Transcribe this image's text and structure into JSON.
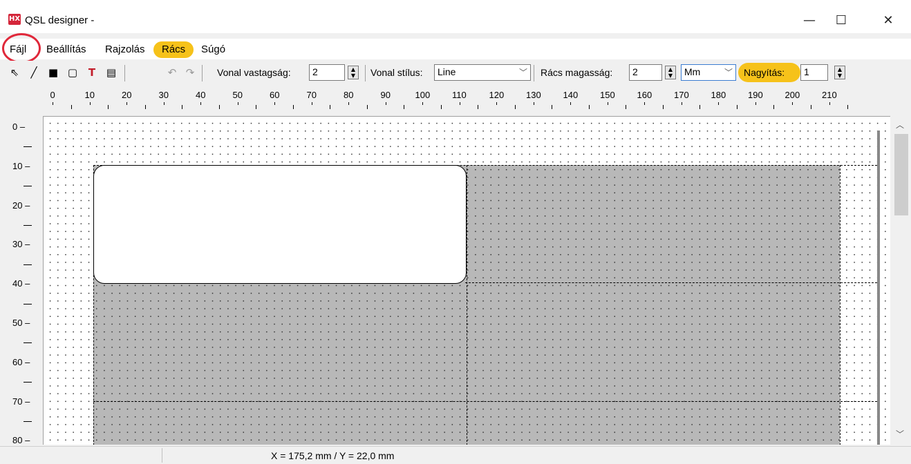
{
  "window": {
    "title": "QSL designer -",
    "minimize": "—",
    "maximize": "☐",
    "close": "✕"
  },
  "menu": [
    "Fájl",
    "Beállítás",
    "Rajzolás",
    "Rács",
    "Súgó"
  ],
  "toolbar": {
    "line_width_label": "Vonal vastagság:",
    "line_width_value": "2",
    "line_style_label": "Vonal stílus:",
    "line_style_value": "Line",
    "grid_height_label": "Rács magasság:",
    "grid_height_value": "2",
    "unit_value": "Mm",
    "zoom_label": "Nagyítás:",
    "zoom_value": "1"
  },
  "ruler": {
    "h_labels": [
      "0",
      "10",
      "20",
      "30",
      "40",
      "50",
      "60",
      "70",
      "80",
      "90",
      "100",
      "110",
      "120",
      "130",
      "140",
      "150",
      "160",
      "170",
      "180",
      "190",
      "200",
      "210"
    ],
    "v_labels": [
      "0",
      "10",
      "20",
      "30",
      "40",
      "50",
      "60",
      "70",
      "80"
    ]
  },
  "status": {
    "coordinates": "X = 175,2 mm / Y = 22,0 mm"
  },
  "colors": {
    "highlight": "#f6c21a",
    "circle": "#e0283a",
    "gray": "#b8b8b8"
  }
}
